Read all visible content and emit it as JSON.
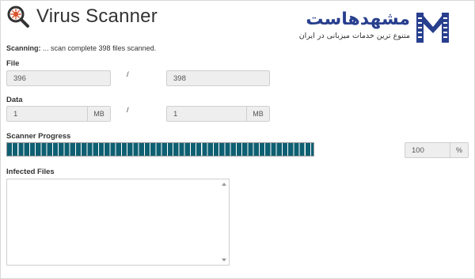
{
  "header": {
    "title": "Virus Scanner",
    "icon": "search-icon"
  },
  "brand": {
    "name": "مشهدهاست",
    "tagline": "متنوع ترین خدمات میزبانی در ایران",
    "color": "#283f8e"
  },
  "status": {
    "label": "Scanning:",
    "message": " ... scan complete 398 files scanned."
  },
  "file": {
    "label": "File",
    "scanned": "396",
    "separator": "/",
    "total": "398"
  },
  "data": {
    "label": "Data",
    "scanned": "1",
    "scanned_unit": "MB",
    "separator": "/",
    "total": "1",
    "total_unit": "MB"
  },
  "progress": {
    "label": "Scanner Progress",
    "percent_value": 100,
    "value": "100",
    "unit": "%",
    "bar_color": "#0e5f72"
  },
  "infected": {
    "label": "Infected Files",
    "content": ""
  }
}
